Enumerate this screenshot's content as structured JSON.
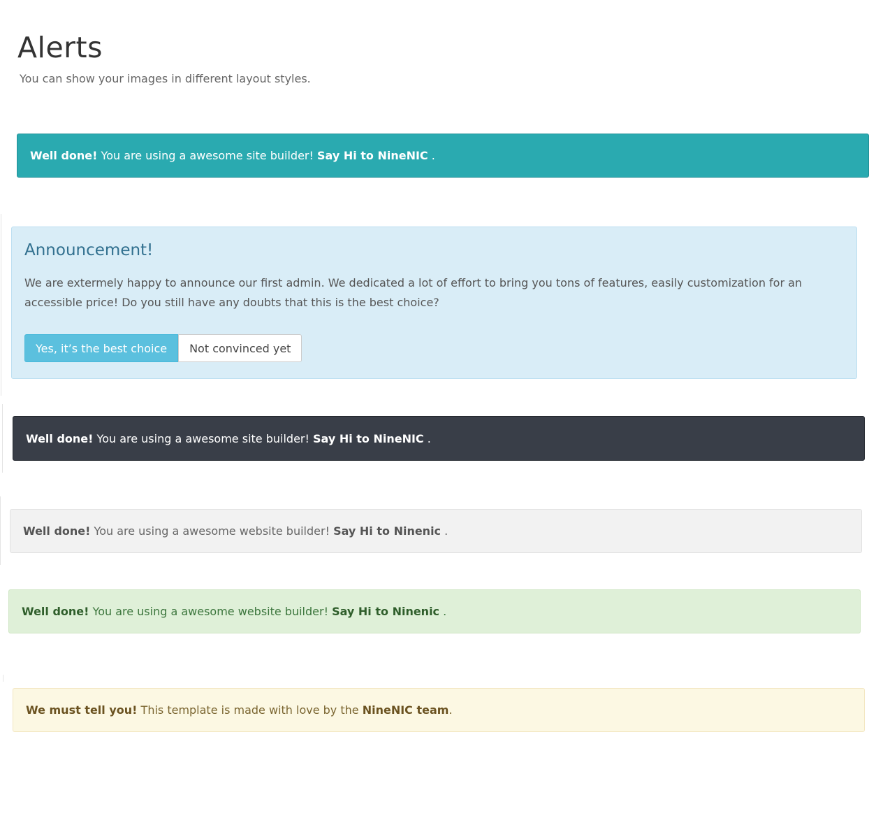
{
  "header": {
    "title": "Alerts",
    "subtitle": "You can show your images in different layout styles."
  },
  "alerts": {
    "teal": {
      "strong": "Well done!",
      "text": " You are using a awesome site builder! ",
      "strong2": "Say Hi to NineNIC",
      "tail": " ."
    },
    "announcement": {
      "title": "Announcement!",
      "body": "We are extermely happy to announce our first admin. We dedicated a lot of effort to bring you tons of features, easily customization for an accessible price! Do you still have any doubts that this is the best choice?",
      "primary_button": "Yes, it’s the best choice",
      "secondary_button": "Not convinced yet"
    },
    "dark": {
      "strong": "Well done!",
      "text": " You are using a awesome site builder! ",
      "strong2": "Say Hi to NineNIC",
      "tail": " ."
    },
    "light": {
      "strong": "Well done!",
      "text": " You are using a awesome website builder! ",
      "strong2": "Say Hi to Ninenic",
      "tail": " ."
    },
    "success": {
      "strong": "Well done!",
      "text": " You are using a awesome website builder! ",
      "strong2": "Say Hi to Ninenic",
      "tail": " ."
    },
    "warning": {
      "strong": "We must tell you!",
      "text": " This template is made with love by the ",
      "strong2": "NineNIC team",
      "tail": "."
    }
  },
  "colors": {
    "teal": "#2aaab0",
    "info_bg": "#d9edf7",
    "info_title": "#31708f",
    "dark": "#393e48",
    "light": "#f2f2f2",
    "success": "#dff0d8",
    "warning": "#fcf8e3",
    "primary_button": "#5bc0de"
  }
}
